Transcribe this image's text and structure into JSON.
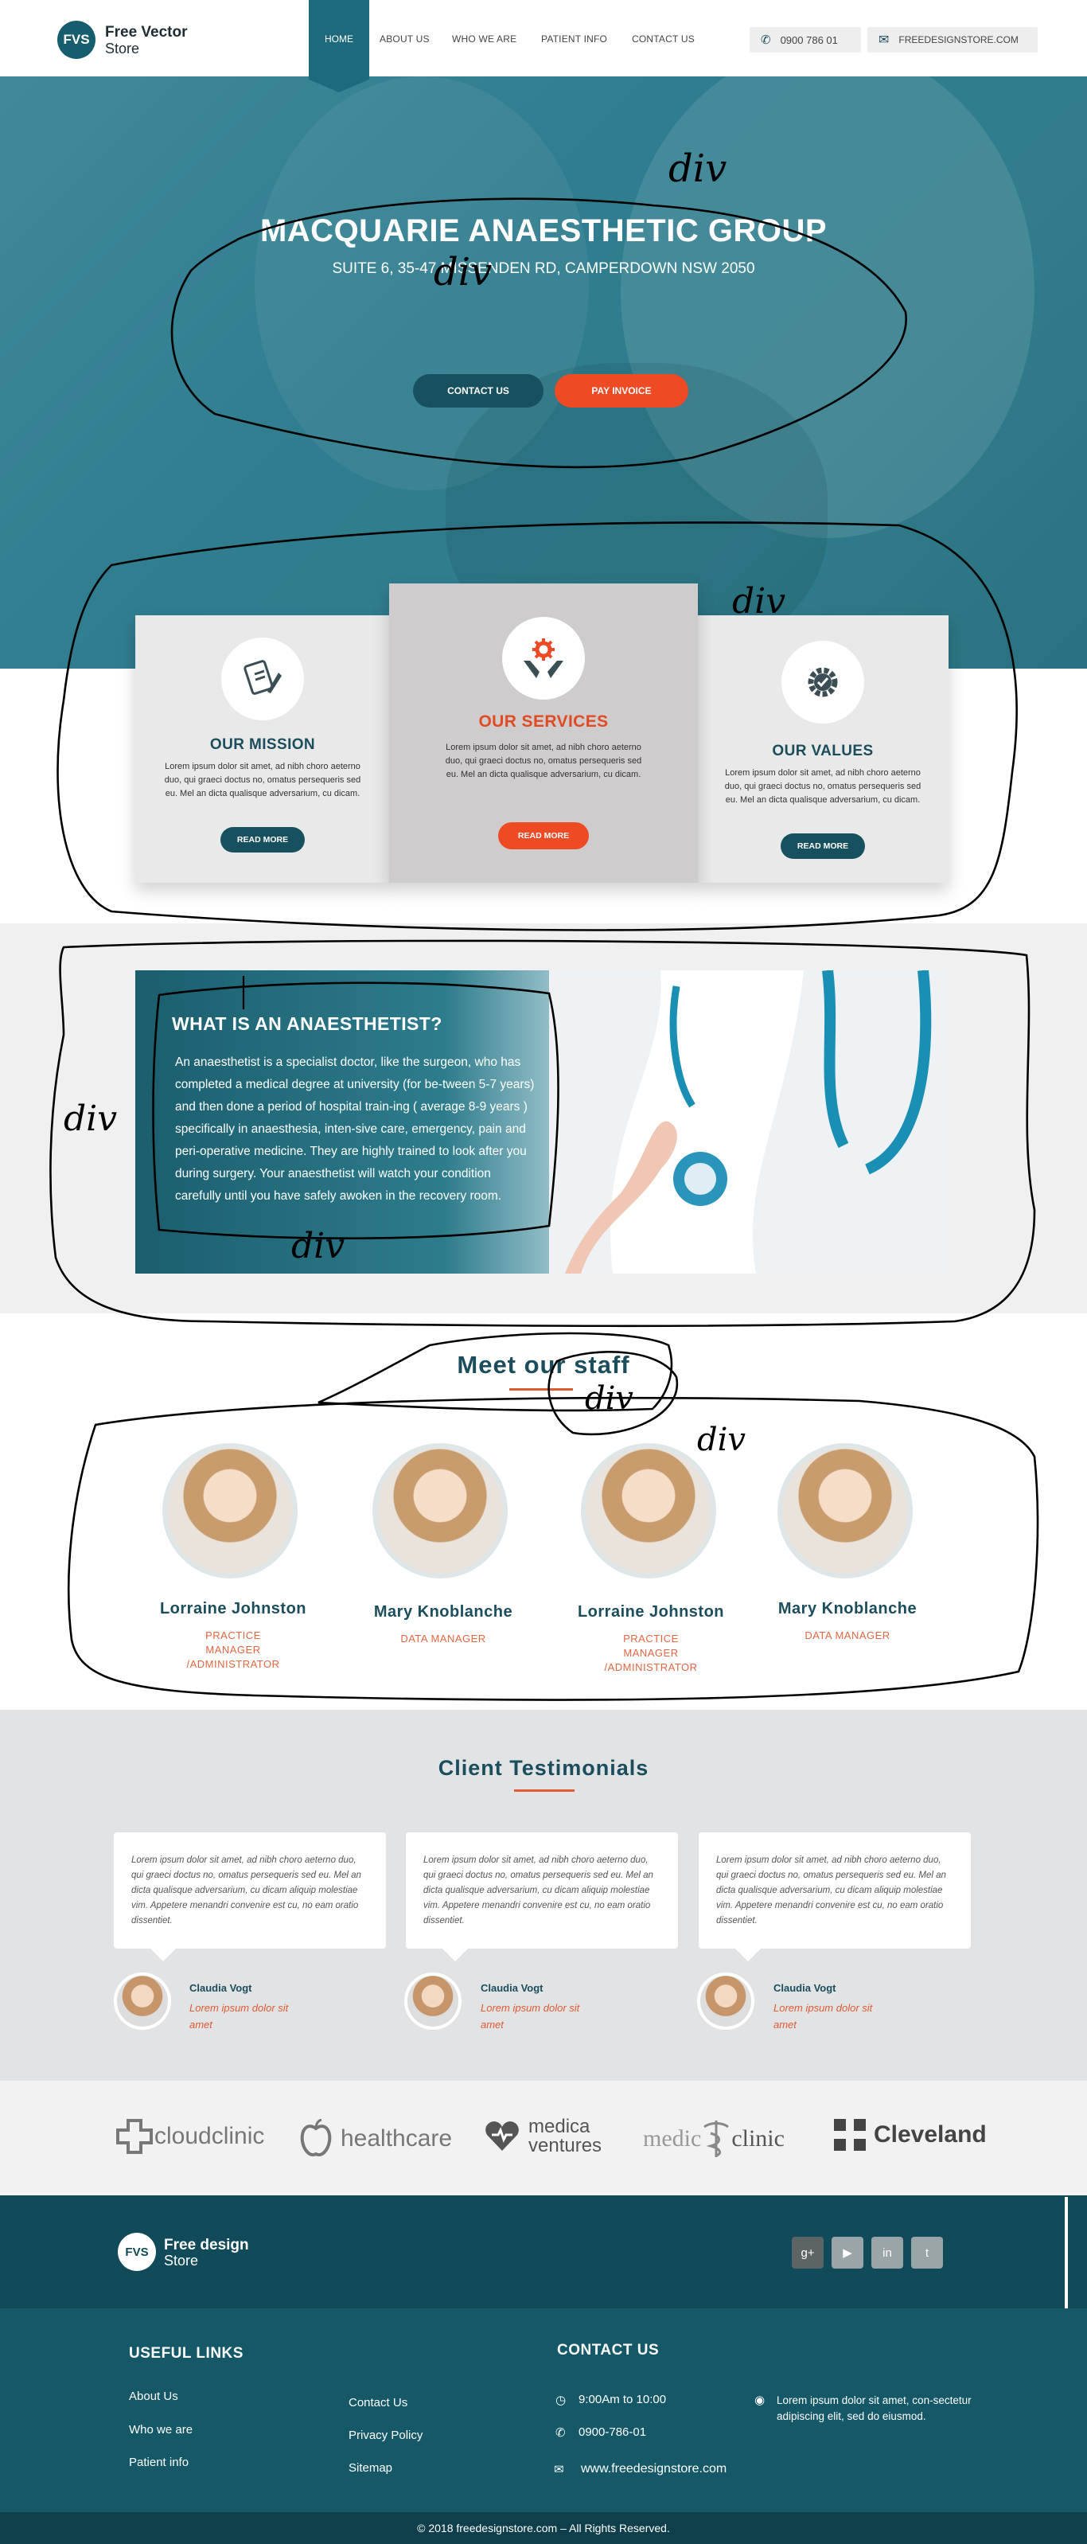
{
  "header": {
    "logo_badge": "FVS",
    "logo_line1": "Free Vector",
    "logo_line2": "Store",
    "nav": [
      "HOME",
      "ABOUT US",
      "WHO WE ARE",
      "PATIENT INFO",
      "CONTACT US"
    ],
    "phone": "0900 786 01",
    "email": "FREEDESIGNSTORE.COM"
  },
  "hero": {
    "title": "MACQUARIE ANAESTHETIC GROUP",
    "subtitle": "SUITE 6, 35-47 MISSENDEN RD, CAMPERDOWN NSW 2050",
    "contact_btn": "CONTACT US",
    "invoice_btn": "PAY INVOICE"
  },
  "cards": [
    {
      "title": "OUR MISSION",
      "text": "Lorem ipsum dolor sit amet, ad nibh choro aeterno duo, qui graeci doctus no, omatus persequeris sed eu. Mel an dicta qualisque adversarium, cu dicam.",
      "button": "READ MORE",
      "icon": "pen-document-icon"
    },
    {
      "title": "OUR SERVICES",
      "text": "Lorem ipsum dolor sit amet, ad nibh choro aeterno duo, qui graeci doctus no, omatus persequeris sed eu. Mel an dicta qualisque adversarium, cu dicam.",
      "button": "READ MORE",
      "icon": "hands-gear-icon"
    },
    {
      "title": "OUR VALUES",
      "text": "Lorem ipsum dolor sit amet, ad nibh choro aeterno duo, qui graeci doctus no, omatus persequeris sed eu. Mel an dicta qualisque adversarium, cu dicam.",
      "button": "READ MORE",
      "icon": "gear-check-icon"
    }
  ],
  "what": {
    "title": "WHAT IS AN ANAESTHETIST?",
    "text": "An anaesthetist is a specialist doctor, like the surgeon, who has completed a medical degree at university (for be-tween 5-7 years) and then done a period of hospital train-ing ( average 8-9 years ) specifically in anaesthesia, inten-sive care, emergency, pain and peri-operative medicine. They are highly trained to look after you during surgery. Your anaesthetist will watch your condition carefully until you have safely awoken in the recovery room."
  },
  "staff": {
    "title": "Meet our staff",
    "members": [
      {
        "name": "Lorraine Johnston",
        "role": "PRACTICE MANAGER /ADMINISTRATOR"
      },
      {
        "name": "Mary Knoblanche",
        "role": "DATA MANAGER"
      },
      {
        "name": "Lorraine Johnston",
        "role": "PRACTICE MANAGER /ADMINISTRATOR"
      },
      {
        "name": "Mary Knoblanche",
        "role": "DATA MANAGER"
      }
    ]
  },
  "testimonials": {
    "title": "Client Testimonials",
    "items": [
      {
        "quote": "Lorem ipsum dolor sit amet, ad nibh choro aeterno duo, qui graeci doctus no, omatus persequeris sed eu. Mel an dicta qualisque adversarium, cu dicam aliquip molestiae vim. Appetere menandri convenire est cu, no eam oratio dissentiet.",
        "name": "Claudia Vogt",
        "desc": "Lorem ipsum dolor sit amet"
      },
      {
        "quote": "Lorem ipsum dolor sit amet, ad nibh choro aeterno duo, qui graeci doctus no, omatus persequeris sed eu. Mel an dicta qualisque adversarium, cu dicam aliquip molestiae vim. Appetere menandri convenire est cu, no eam oratio dissentiet.",
        "name": "Claudia Vogt",
        "desc": "Lorem ipsum dolor sit amet"
      },
      {
        "quote": "Lorem ipsum dolor sit amet, ad nibh choro aeterno duo, qui graeci doctus no, omatus persequeris sed eu. Mel an dicta qualisque adversarium, cu dicam aliquip molestiae vim. Appetere menandri convenire est cu, no eam oratio dissentiet.",
        "name": "Claudia Vogt",
        "desc": "Lorem ipsum dolor sit amet"
      }
    ]
  },
  "partners": [
    {
      "name": "cloudclinic",
      "icon": "cross-icon"
    },
    {
      "name": "healthcare",
      "icon": "apple-icon"
    },
    {
      "name1": "medica",
      "name2": "ventures",
      "icon": "heart-icon"
    },
    {
      "name": "medic",
      "name_b": "clinic",
      "icon": "caduceus-icon"
    },
    {
      "name": "Cleveland",
      "icon": "square-cross-icon"
    }
  ],
  "footer": {
    "logo_badge": "FVS",
    "logo_line1": "Free design",
    "logo_line2": "Store",
    "social": [
      "g+",
      "▶",
      "in",
      "t"
    ],
    "useful_links_title": "USEFUL LINKS",
    "links_col1": [
      "About Us",
      "Who we are",
      "Patient info"
    ],
    "links_col2": [
      "Contact Us",
      "Privacy Policy",
      "Sitemap"
    ],
    "contact_title": "CONTACT US",
    "hours": "9:00Am to 10:00",
    "phone": "0900-786-01",
    "website": "www.freedesignstore.com",
    "address": "Lorem ipsum dolor sit amet, con-sectetur adipiscing elit, sed do eiusmod.",
    "copyright": "© 2018 freedesignstore.com – All Rights Reserved."
  },
  "annotations": [
    "div",
    "div",
    "div",
    "div",
    "div",
    "div",
    "div"
  ],
  "colors": {
    "teal": "#165d6e",
    "orange": "#ee4a23",
    "dark_teal": "#17505e"
  }
}
